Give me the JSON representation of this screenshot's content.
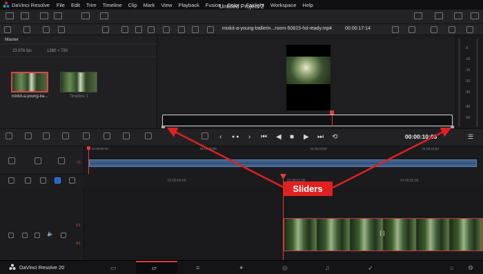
{
  "menubar": {
    "app_name": "DaVinci Resolve",
    "items": [
      "File",
      "Edit",
      "Trim",
      "Timeline",
      "Clip",
      "Mark",
      "View",
      "Playback",
      "Fusion",
      "Color",
      "Fairlight",
      "Workspace",
      "Help"
    ]
  },
  "title": "Untitled Project 2",
  "viewer": {
    "clip_name": "mixkit-a-young-ballerin...room-50815-hd-ready.mp4",
    "timecode_top": "00:00:17:14",
    "timecode_main": "00:00:10:03"
  },
  "media_pool": {
    "bin": "Master",
    "fps": "23.976 fps",
    "resolution": "1280 × 720",
    "items": [
      {
        "label": "mixkit-a-young-ba..."
      },
      {
        "label": "Timeline 1"
      }
    ]
  },
  "audio_meter": {
    "labels": [
      "-5",
      "-10",
      "-15",
      "-20",
      "-30",
      "-40",
      "-50"
    ]
  },
  "upper_timeline": {
    "track": "V1",
    "ruler": [
      "01:00:00:00",
      "01:00:05:00",
      "01:00:10:00",
      "01:00:15:00"
    ]
  },
  "lower_timeline": {
    "ruler": [
      "01:00:00:00",
      "01:00:01:00",
      "01:00:02:00"
    ],
    "tracks": [
      "V1",
      "A1"
    ],
    "clip_marker": "[·]"
  },
  "annotation": {
    "label": "Sliders",
    "color": "#e02121"
  },
  "bottom": {
    "app_name": "DaVinci Resolve 20",
    "pages": [
      "media",
      "cut",
      "edit",
      "fusion",
      "color",
      "fairlight",
      "deliver"
    ],
    "active_page": "cut"
  },
  "colors": {
    "accent": "#e23b3b",
    "clip": "#3f5f89",
    "blue_icon": "#2a63c4"
  }
}
